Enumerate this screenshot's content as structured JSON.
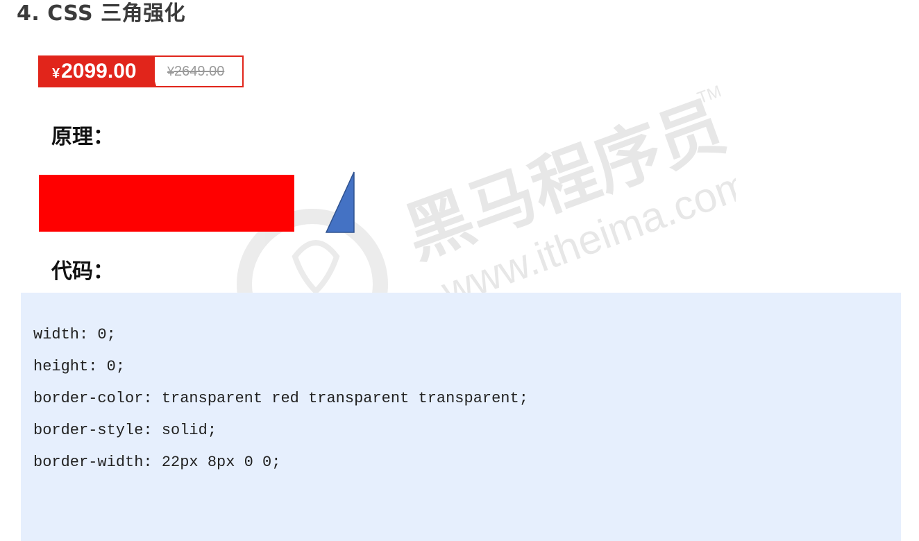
{
  "heading": "4. CSS 三角强化",
  "price_badge": {
    "currency": "¥",
    "current_price": "2099.00",
    "original_price": "2649.00"
  },
  "sections": {
    "principle_label": "原理：",
    "code_label": "代码："
  },
  "watermark": {
    "brand": "黑马程序员",
    "site": "www.itheima.com",
    "trademark": "TM"
  },
  "code_lines": [
    "width: 0;",
    "height: 0;",
    "border-color: transparent red transparent transparent;",
    "border-style: solid;",
    "border-width: 22px 8px 0 0;"
  ],
  "colors": {
    "badge_red": "#e1251b",
    "demo_rect": "#ff0000",
    "triangle_fill": "#4472c4",
    "code_bg": "#e6effd"
  }
}
